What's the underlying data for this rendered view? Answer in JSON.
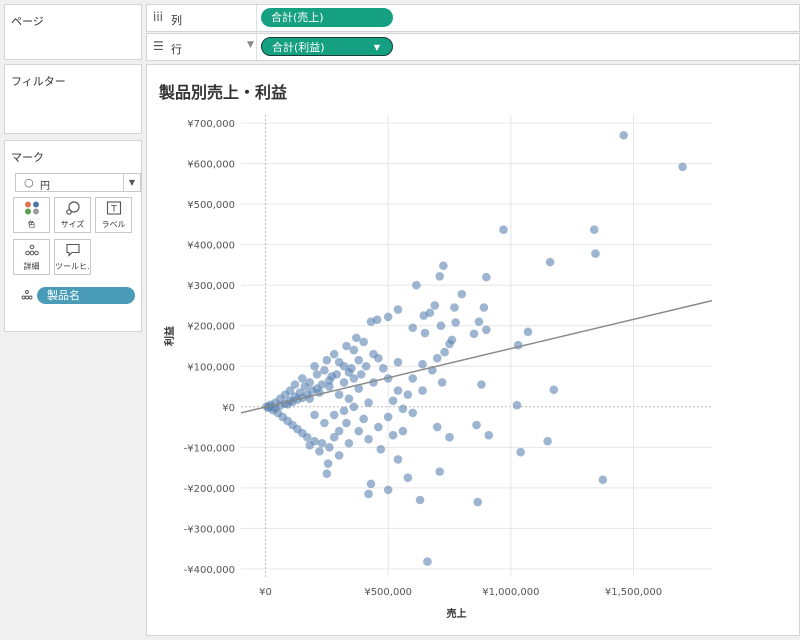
{
  "sidebar": {
    "pages_title": "ページ",
    "filters_title": "フィルター",
    "marks": {
      "title": "マーク",
      "type_label": "円",
      "buttons": [
        {
          "icon": "color-icon",
          "label": "色"
        },
        {
          "icon": "size-icon",
          "label": "サイズ"
        },
        {
          "icon": "label-icon",
          "label": "ラベル",
          "glyph": "T"
        },
        {
          "icon": "detail-icon",
          "label": "詳細"
        },
        {
          "icon": "tooltip-icon",
          "label": "ツールヒ…"
        }
      ],
      "detail_field": "製品名"
    }
  },
  "shelves": {
    "columns": {
      "icon": "iii",
      "label": "列",
      "pill": "合計(売上)"
    },
    "rows": {
      "icon": "☰",
      "label": "行",
      "pill": "合計(利益)"
    }
  },
  "viz": {
    "title": "製品別売上・利益",
    "colors": {
      "mark": "#5b84b1",
      "trend": "#8a8a8a",
      "grid": "#e6e6e6",
      "pill": "#16a082"
    }
  },
  "chart_data": {
    "type": "scatter",
    "title": "製品別売上・利益",
    "xlabel": "売上",
    "ylabel": "利益",
    "xlim": [
      -100000,
      1820000
    ],
    "ylim": [
      -420000,
      720000
    ],
    "x_ticks": [
      0,
      500000,
      1000000,
      1500000
    ],
    "x_tick_labels": [
      "¥0",
      "¥500,000",
      "¥1,000,000",
      "¥1,500,000"
    ],
    "y_ticks": [
      700000,
      600000,
      500000,
      400000,
      300000,
      200000,
      100000,
      0,
      -100000,
      -200000,
      -300000,
      -400000
    ],
    "y_tick_labels": [
      "¥700,000",
      "¥600,000",
      "¥500,000",
      "¥400,000",
      "¥300,000",
      "¥200,000",
      "¥100,000",
      "¥0",
      "-¥100,000",
      "-¥200,000",
      "-¥300,000",
      "-¥400,000"
    ],
    "grid": true,
    "trend_line": {
      "x": [
        -100000,
        1820000
      ],
      "y": [
        -15000,
        262000
      ]
    },
    "points": [
      [
        1460000,
        670000
      ],
      [
        1700000,
        592000
      ],
      [
        970000,
        437000
      ],
      [
        1340000,
        437000
      ],
      [
        1345000,
        378000
      ],
      [
        1160000,
        357000
      ],
      [
        725000,
        348000
      ],
      [
        900000,
        320000
      ],
      [
        710000,
        322000
      ],
      [
        615000,
        300000
      ],
      [
        800000,
        278000
      ],
      [
        770000,
        245000
      ],
      [
        690000,
        250000
      ],
      [
        670000,
        232000
      ],
      [
        645000,
        225000
      ],
      [
        540000,
        240000
      ],
      [
        500000,
        222000
      ],
      [
        455000,
        215000
      ],
      [
        430000,
        210000
      ],
      [
        890000,
        245000
      ],
      [
        870000,
        210000
      ],
      [
        775000,
        208000
      ],
      [
        715000,
        200000
      ],
      [
        650000,
        182000
      ],
      [
        600000,
        195000
      ],
      [
        1070000,
        185000
      ],
      [
        1030000,
        152000
      ],
      [
        900000,
        190000
      ],
      [
        850000,
        180000
      ],
      [
        760000,
        165000
      ],
      [
        1175000,
        42000
      ],
      [
        1025000,
        4000
      ],
      [
        880000,
        55000
      ],
      [
        750000,
        155000
      ],
      [
        730000,
        135000
      ],
      [
        700000,
        120000
      ],
      [
        640000,
        105000
      ],
      [
        680000,
        90000
      ],
      [
        600000,
        70000
      ],
      [
        720000,
        60000
      ],
      [
        640000,
        40000
      ],
      [
        540000,
        40000
      ],
      [
        580000,
        30000
      ],
      [
        520000,
        15000
      ],
      [
        560000,
        -5000
      ],
      [
        600000,
        -15000
      ],
      [
        500000,
        -25000
      ],
      [
        560000,
        -60000
      ],
      [
        700000,
        -50000
      ],
      [
        1150000,
        -85000
      ],
      [
        1040000,
        -112000
      ],
      [
        860000,
        -45000
      ],
      [
        910000,
        -70000
      ],
      [
        750000,
        -75000
      ],
      [
        540000,
        -130000
      ],
      [
        470000,
        -105000
      ],
      [
        420000,
        -80000
      ],
      [
        380000,
        -60000
      ],
      [
        430000,
        -190000
      ],
      [
        1375000,
        -180000
      ],
      [
        710000,
        -160000
      ],
      [
        580000,
        -175000
      ],
      [
        500000,
        -205000
      ],
      [
        420000,
        -215000
      ],
      [
        630000,
        -230000
      ],
      [
        865000,
        -235000
      ],
      [
        660000,
        -382000
      ],
      [
        250000,
        -165000
      ],
      [
        255000,
        -140000
      ],
      [
        220000,
        -110000
      ],
      [
        180000,
        -95000
      ],
      [
        300000,
        -120000
      ],
      [
        340000,
        -90000
      ],
      [
        330000,
        -40000
      ],
      [
        360000,
        70000
      ],
      [
        340000,
        85000
      ],
      [
        390000,
        80000
      ],
      [
        330000,
        150000
      ],
      [
        300000,
        110000
      ],
      [
        370000,
        170000
      ],
      [
        400000,
        160000
      ],
      [
        360000,
        140000
      ],
      [
        250000,
        115000
      ],
      [
        280000,
        130000
      ],
      [
        200000,
        100000
      ],
      [
        150000,
        70000
      ],
      [
        120000,
        55000
      ],
      [
        100000,
        40000
      ],
      [
        80000,
        30000
      ],
      [
        60000,
        20000
      ],
      [
        40000,
        10000
      ],
      [
        20000,
        5000
      ],
      [
        10000,
        -2000
      ],
      [
        30000,
        -8000
      ],
      [
        50000,
        -15000
      ],
      [
        70000,
        -25000
      ],
      [
        90000,
        -35000
      ],
      [
        110000,
        -45000
      ],
      [
        130000,
        -55000
      ],
      [
        150000,
        -65000
      ],
      [
        170000,
        -75000
      ],
      [
        200000,
        -85000
      ],
      [
        230000,
        -90000
      ],
      [
        260000,
        -100000
      ],
      [
        280000,
        -75000
      ],
      [
        300000,
        -60000
      ],
      [
        320000,
        60000
      ],
      [
        270000,
        75000
      ],
      [
        240000,
        90000
      ],
      [
        210000,
        80000
      ],
      [
        180000,
        60000
      ],
      [
        160000,
        50000
      ],
      [
        140000,
        35000
      ],
      [
        120000,
        25000
      ],
      [
        100000,
        15000
      ],
      [
        80000,
        8000
      ],
      [
        60000,
        3000
      ],
      [
        40000,
        -3000
      ],
      [
        20000,
        -1000
      ],
      [
        5000,
        1000
      ],
      [
        180000,
        20000
      ],
      [
        200000,
        -20000
      ],
      [
        220000,
        35000
      ],
      [
        240000,
        -40000
      ],
      [
        260000,
        50000
      ],
      [
        280000,
        -20000
      ],
      [
        300000,
        30000
      ],
      [
        320000,
        -10000
      ],
      [
        340000,
        20000
      ],
      [
        360000,
        0
      ],
      [
        380000,
        45000
      ],
      [
        400000,
        -30000
      ],
      [
        420000,
        10000
      ],
      [
        440000,
        60000
      ],
      [
        460000,
        -50000
      ],
      [
        480000,
        95000
      ],
      [
        500000,
        70000
      ],
      [
        520000,
        -70000
      ],
      [
        540000,
        110000
      ],
      [
        460000,
        120000
      ],
      [
        440000,
        130000
      ],
      [
        410000,
        100000
      ],
      [
        380000,
        115000
      ],
      [
        350000,
        95000
      ],
      [
        320000,
        100000
      ],
      [
        290000,
        80000
      ],
      [
        260000,
        65000
      ],
      [
        230000,
        55000
      ],
      [
        210000,
        45000
      ],
      [
        190000,
        40000
      ],
      [
        170000,
        30000
      ],
      [
        150000,
        22000
      ],
      [
        130000,
        18000
      ],
      [
        110000,
        12000
      ],
      [
        90000,
        6000
      ]
    ]
  }
}
